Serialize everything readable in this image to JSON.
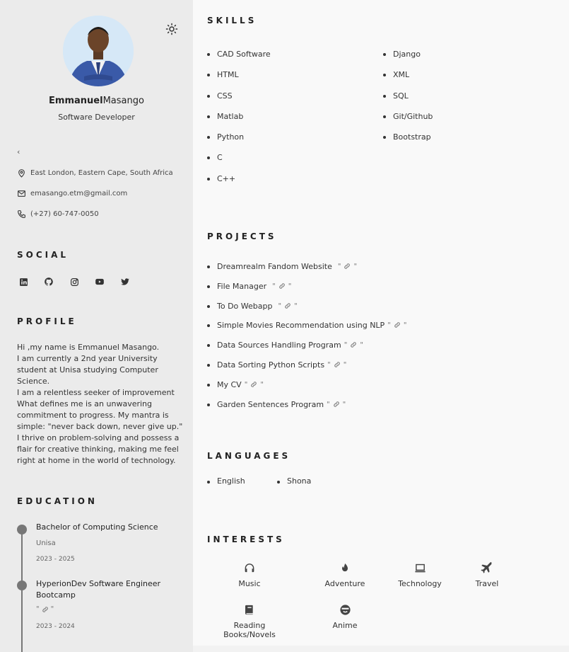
{
  "profile_header": {
    "first_name": "Emmanuel",
    "last_name": "Masango",
    "role": "Software Developer",
    "collapse_glyph": "‹"
  },
  "contact": {
    "location": "East London, Eastern Cape, South Africa",
    "email": "emasango.etm@gmail.com",
    "phone": "(+27) 60-747-0050"
  },
  "social": {
    "title": "SOCIAL",
    "icons": [
      "linkedin-icon",
      "github-icon",
      "instagram-icon",
      "youtube-icon",
      "twitter-icon"
    ]
  },
  "profile": {
    "title": "PROFILE",
    "lines": [
      "Hi ,my name is Emmanuel Masango.",
      "I am currently a 2nd year University student at Unisa studying Computer Science.",
      "I am a relentless seeker of improvement What defines me is an unwavering commitment to progress. My mantra is simple: \"never back down, never give up.\"",
      "I thrive on problem-solving and possess a flair for creative thinking, making me feel right at home in the world of technology."
    ]
  },
  "education": {
    "title": "EDUCATION",
    "items": [
      {
        "degree": "Bachelor of Computing Science",
        "institution": "Unisa",
        "years": "2023 - 2025"
      },
      {
        "degree": "HyperionDev Software Engineer Bootcamp",
        "institution": "",
        "years": "2023 - 2024"
      }
    ]
  },
  "skills": {
    "title": "SKILLS",
    "col1": [
      "CAD Software",
      "HTML",
      "CSS",
      "Matlab",
      "Python",
      "C",
      "C++"
    ],
    "col2": [
      "Django",
      "XML",
      "SQL",
      "Git/Github",
      "Bootstrap"
    ]
  },
  "projects": {
    "title": "PROJECTS",
    "quote": "\"",
    "items": [
      "Dreamrealm Fandom Website",
      "File Manager",
      "To Do Webapp",
      "Simple Movies Recommendation using NLP",
      "Data Sources Handling Program",
      "Data Sorting Python Scripts",
      "My CV",
      "Garden Sentences Program"
    ]
  },
  "languages": {
    "title": "LANGUAGES",
    "items": [
      "English",
      "Shona"
    ]
  },
  "interests": {
    "title": "INTERESTS",
    "items": [
      {
        "label": "Music",
        "icon": "headphones-icon"
      },
      {
        "label": "Adventure",
        "icon": "fire-icon"
      },
      {
        "label": "Technology",
        "icon": "laptop-icon"
      },
      {
        "label": "Travel",
        "icon": "plane-icon"
      },
      {
        "label": "Reading Books/Novels",
        "icon": "book-icon"
      },
      {
        "label": "Anime",
        "icon": "face-icon"
      }
    ]
  },
  "colors": {
    "sidebar_bg": "#ebebeb",
    "main_bg": "#f9f9f9",
    "timeline": "#777777",
    "avatar_bg": "#cfe4f5",
    "suit": "#3a5aa8"
  }
}
